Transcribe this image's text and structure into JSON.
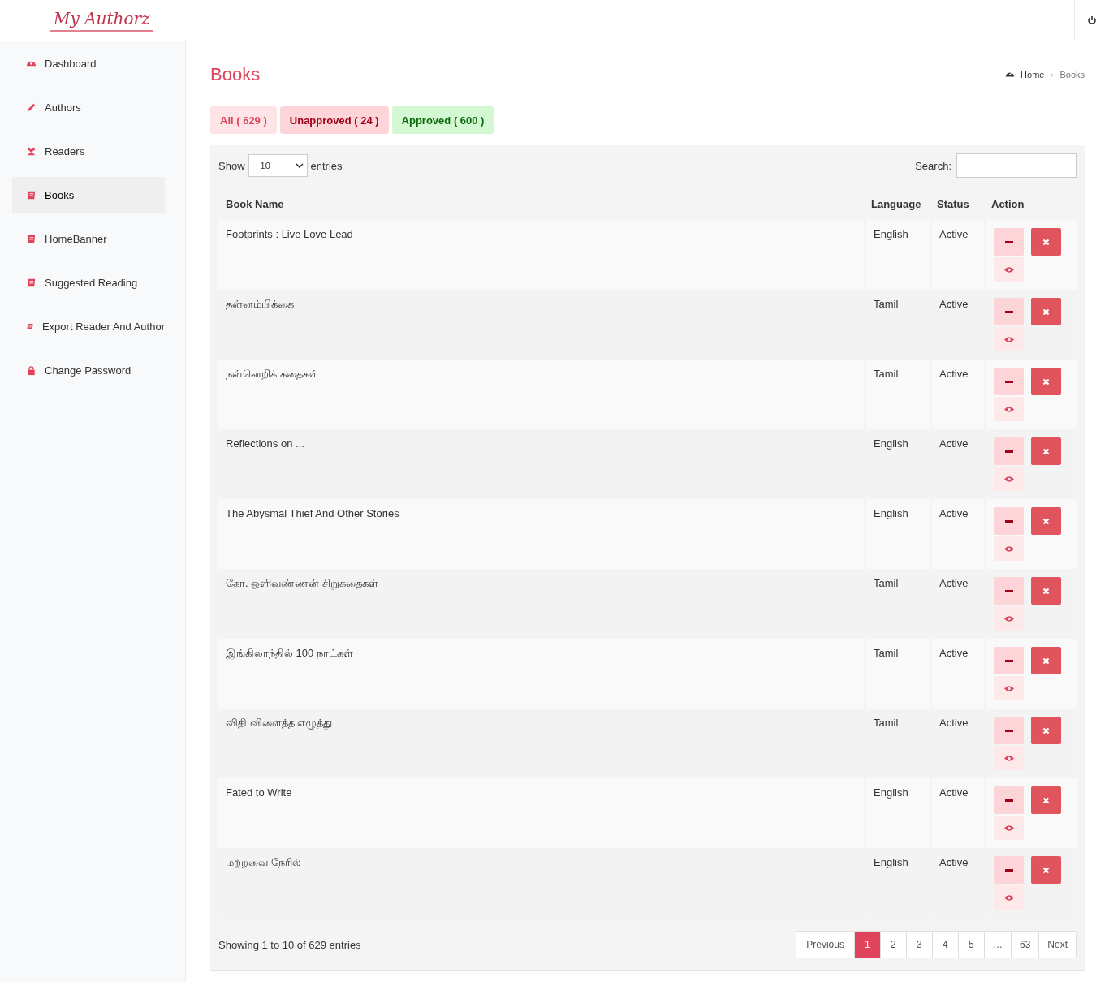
{
  "header": {
    "logo": "My Authorz"
  },
  "sidebar": {
    "items": [
      {
        "label": "Dashboard",
        "selected": false
      },
      {
        "label": "Authors",
        "selected": false
      },
      {
        "label": "Readers",
        "selected": false
      },
      {
        "label": "Books",
        "selected": true
      },
      {
        "label": "HomeBanner",
        "selected": false
      },
      {
        "label": "Suggested Reading",
        "selected": false
      },
      {
        "label": "Export Reader And Author",
        "selected": false
      },
      {
        "label": "Change Password",
        "selected": false
      }
    ]
  },
  "page": {
    "title": "Books",
    "breadcrumb": [
      "Home",
      "Books"
    ]
  },
  "filters": [
    {
      "label": "All ( 629 )",
      "kind": "all"
    },
    {
      "label": "Unapproved ( 24 )",
      "kind": "unapproved"
    },
    {
      "label": "Approved ( 600 )",
      "kind": "approved"
    }
  ],
  "table": {
    "show_label": "Show",
    "page_size": "10",
    "entries_label": "entries",
    "search_label": "Search:",
    "columns": [
      "Book Name",
      "Language",
      "Status",
      "Action"
    ],
    "rows": [
      {
        "name": "Footprints : Live Love Lead",
        "language": "English",
        "status": "Active"
      },
      {
        "name": "தன்னம்பிக்கை",
        "language": "Tamil",
        "status": "Active"
      },
      {
        "name": "நன்னெறிக் கதைகள்",
        "language": "Tamil",
        "status": "Active"
      },
      {
        "name": "Reflections on ...",
        "language": "English",
        "status": "Active"
      },
      {
        "name": "The Abysmal Thief And Other Stories",
        "language": "English",
        "status": "Active"
      },
      {
        "name": "கோ. ஒளிவண்ணன் சிறுகதைகள்",
        "language": "Tamil",
        "status": "Active"
      },
      {
        "name": "இங்கிலாந்தில் 100 நாட்கள்",
        "language": "Tamil",
        "status": "Active"
      },
      {
        "name": "விதி விளைத்த எழுத்து",
        "language": "Tamil",
        "status": "Active"
      },
      {
        "name": "Fated to Write",
        "language": "English",
        "status": "Active"
      },
      {
        "name": "மற்றவை நேரில்",
        "language": "English",
        "status": "Active"
      }
    ],
    "info": "Showing 1 to 10 of 629 entries",
    "pagination": [
      {
        "label": "Previous",
        "selected": false
      },
      {
        "label": "1",
        "selected": true
      },
      {
        "label": "2",
        "selected": false
      },
      {
        "label": "3",
        "selected": false
      },
      {
        "label": "4",
        "selected": false
      },
      {
        "label": "5",
        "selected": false
      },
      {
        "label": "…",
        "selected": false
      },
      {
        "label": "63",
        "selected": false
      },
      {
        "label": "Next",
        "selected": false
      }
    ]
  }
}
